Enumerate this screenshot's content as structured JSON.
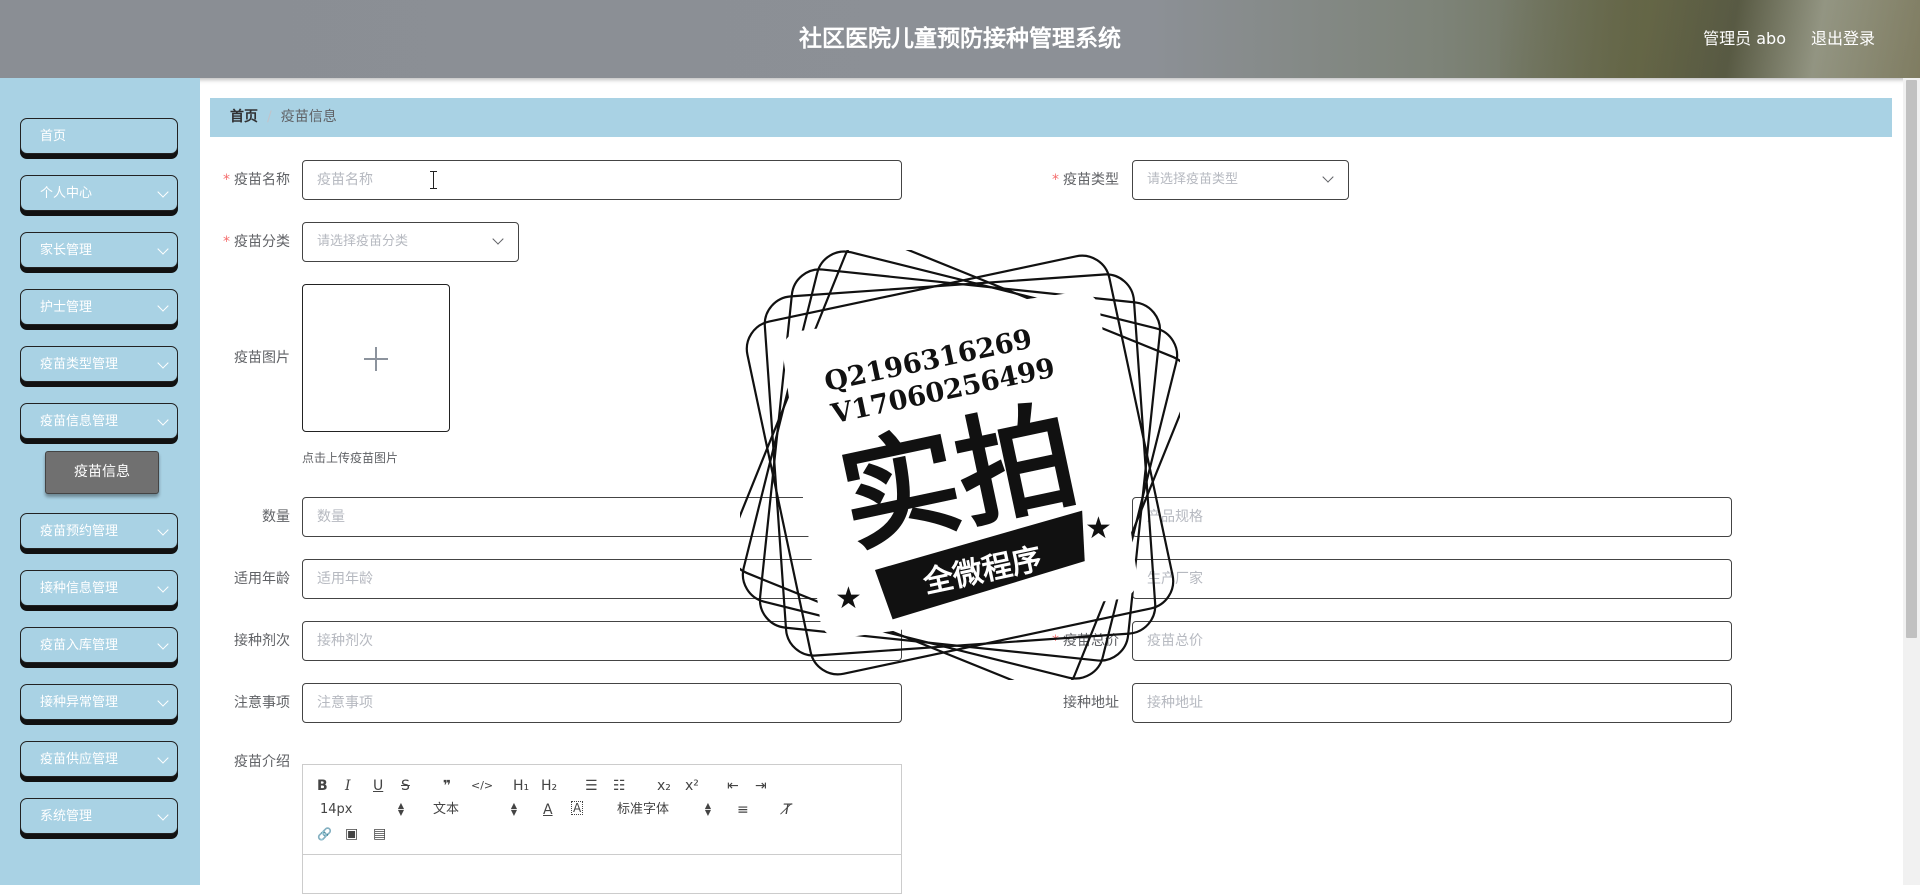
{
  "header": {
    "title": "社区医院儿童预防接种管理系统",
    "user_label": "管理员 abo",
    "logout_label": "退出登录"
  },
  "sidebar": {
    "items": [
      {
        "label": "首页"
      },
      {
        "label": "个人中心"
      },
      {
        "label": "家长管理"
      },
      {
        "label": "护士管理"
      },
      {
        "label": "疫苗类型管理"
      },
      {
        "label": "疫苗信息管理"
      },
      {
        "label": "疫苗预约管理"
      },
      {
        "label": "接种信息管理"
      },
      {
        "label": "疫苗入库管理"
      },
      {
        "label": "接种异常管理"
      },
      {
        "label": "疫苗供应管理"
      },
      {
        "label": "系统管理"
      }
    ],
    "active_sub": "疫苗信息"
  },
  "breadcrumb": {
    "home": "首页",
    "separator": "/",
    "current": "疫苗信息"
  },
  "form": {
    "vaccine_name": {
      "label": "疫苗名称",
      "placeholder": "疫苗名称",
      "value": ""
    },
    "vaccine_type": {
      "label": "疫苗类型",
      "placeholder": "请选择疫苗类型"
    },
    "vaccine_category": {
      "label": "疫苗分类",
      "placeholder": "请选择疫苗分类"
    },
    "vaccine_image": {
      "label": "疫苗图片",
      "tip": "点击上传疫苗图片"
    },
    "quantity": {
      "label": "数量",
      "placeholder": "数量",
      "value": ""
    },
    "spec": {
      "label": "产品规格",
      "placeholder": "产品规格",
      "value": ""
    },
    "age": {
      "label": "适用年龄",
      "placeholder": "适用年龄",
      "value": ""
    },
    "manufacturer": {
      "label": "生产厂家",
      "placeholder": "生产厂家",
      "value": ""
    },
    "dose": {
      "label": "接种剂次",
      "placeholder": "接种剂次",
      "value": ""
    },
    "total_price": {
      "label": "疫苗总价",
      "placeholder": "疫苗总价",
      "value": ""
    },
    "notes": {
      "label": "注意事项",
      "placeholder": "注意事项",
      "value": ""
    },
    "address": {
      "label": "接种地址",
      "placeholder": "接种地址",
      "value": ""
    },
    "intro": {
      "label": "疫苗介绍"
    }
  },
  "editor": {
    "font_size": "14px",
    "format": "文本",
    "font_family": "标准字体",
    "btn_bold": "B",
    "btn_italic": "I",
    "btn_underline": "U",
    "btn_strike": "S",
    "btn_quote": "❞",
    "btn_code": "</>",
    "btn_h1": "H₁",
    "btn_h2": "H₂",
    "btn_ol": "☰",
    "btn_ul": "☷",
    "btn_sub": "x₂",
    "btn_sup": "x²",
    "btn_outdent": "⇤",
    "btn_indent": "⇥",
    "btn_color": "A",
    "btn_bg": "A",
    "btn_align": "≡",
    "btn_clear": "T̸",
    "btn_link": "🔗",
    "btn_image": "▣",
    "btn_video": "▤"
  },
  "watermark": {
    "line1": "Q2196316269",
    "line2": "V17060256499",
    "big": "实拍",
    "banner": "全微程序"
  },
  "colors": {
    "sidebar_bg": "#a9d2e4",
    "header_bg": "#8a8e94",
    "required": "#f56c6c"
  }
}
